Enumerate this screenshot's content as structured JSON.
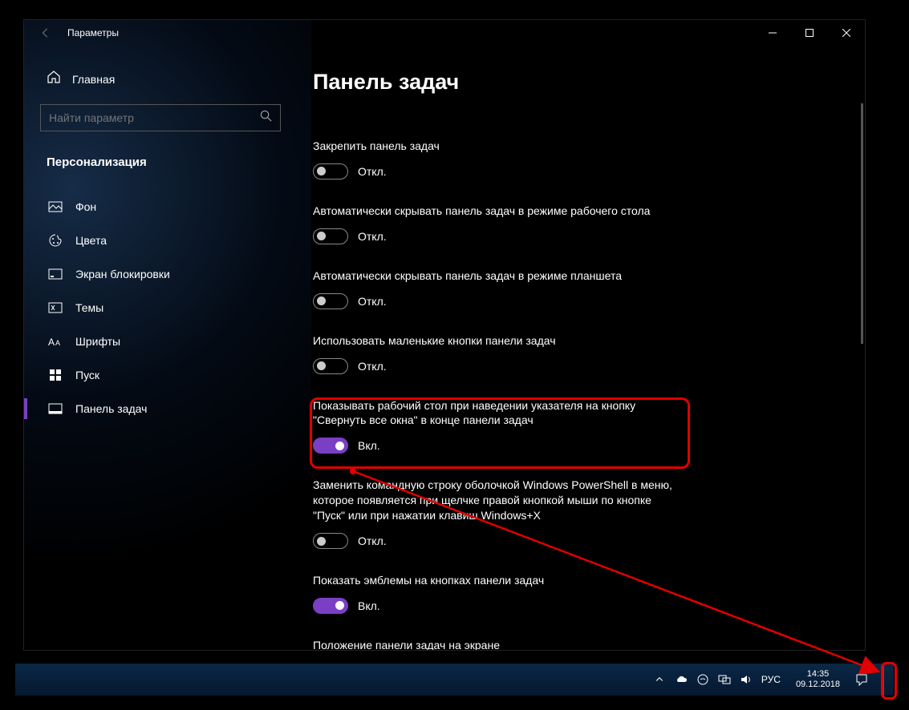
{
  "window": {
    "title": "Параметры"
  },
  "sidebar": {
    "home": "Главная",
    "search_placeholder": "Найти параметр",
    "group": "Персонализация",
    "items": [
      {
        "label": "Фон"
      },
      {
        "label": "Цвета"
      },
      {
        "label": "Экран блокировки"
      },
      {
        "label": "Темы"
      },
      {
        "label": "Шрифты"
      },
      {
        "label": "Пуск"
      },
      {
        "label": "Панель задач"
      }
    ]
  },
  "content": {
    "heading": "Панель задач",
    "settings": [
      {
        "label": "Закрепить панель задач",
        "on": false,
        "state": "Откл."
      },
      {
        "label": "Автоматически скрывать панель задач в режиме рабочего стола",
        "on": false,
        "state": "Откл."
      },
      {
        "label": "Автоматически скрывать панель задач в режиме планшета",
        "on": false,
        "state": "Откл."
      },
      {
        "label": "Использовать маленькие кнопки панели задач",
        "on": false,
        "state": "Откл."
      },
      {
        "label": "Показывать рабочий стол при наведении указателя на кнопку \"Свернуть все окна\" в конце панели задач",
        "on": true,
        "state": "Вкл."
      },
      {
        "label": "Заменить командную строку оболочкой Windows PowerShell в меню, которое появляется при щелчке правой кнопкой мыши по кнопке \"Пуск\" или при нажатии клавиш Windows+X",
        "on": false,
        "state": "Откл."
      },
      {
        "label": "Показать эмблемы на кнопках панели задач",
        "on": true,
        "state": "Вкл."
      },
      {
        "label": "Положение панели задач на экране",
        "on": null,
        "state": ""
      }
    ]
  },
  "taskbar": {
    "lang": "РУС",
    "time": "14:35",
    "date": "09.12.2018"
  }
}
